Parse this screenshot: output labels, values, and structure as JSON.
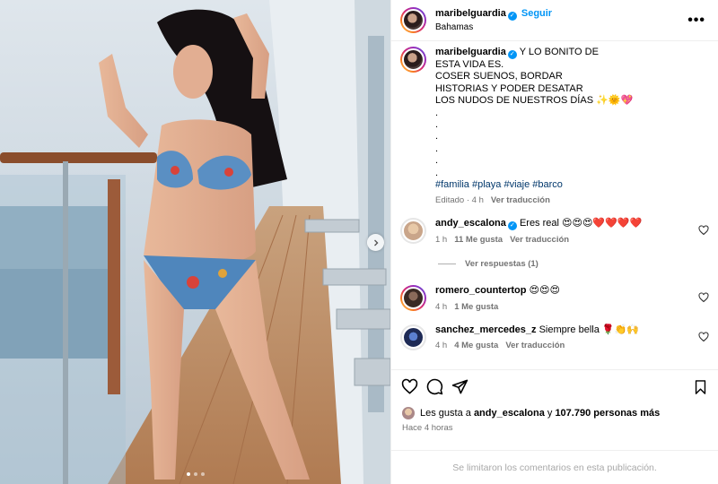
{
  "post": {
    "author": "maribelguardia",
    "follow_label": "Seguir",
    "location": "Bahamas",
    "more_label": "•••"
  },
  "caption": {
    "author": "maribelguardia",
    "lines": [
      "Y LO BONITO DE",
      "ESTA VIDA ES.",
      "COSER SUENOS, BORDAR",
      "HISTORIAS Y PODER DESATAR",
      "LOS NUDOS DE NUESTROS DÍAS ✨🌞💖"
    ],
    "dots": [
      ".",
      ".",
      ".",
      ".",
      ".",
      "."
    ],
    "hashtags": [
      "#familia",
      "#playa",
      "#viaje",
      "#barco"
    ],
    "meta": {
      "edited": "Editado · 4 h",
      "translate": "Ver traducción"
    }
  },
  "comments": [
    {
      "user": "andy_escalona",
      "verified": true,
      "text": "Eres real 😍😍😍❤️❤️❤️❤️",
      "time": "1 h",
      "likes": "11 Me gusta",
      "translate": "Ver traducción",
      "replies": "Ver respuestas (1)"
    },
    {
      "user": "romero_countertop",
      "verified": false,
      "text": "😍😍😍",
      "time": "4 h",
      "likes": "1 Me gusta",
      "translate": ""
    },
    {
      "user": "sanchez_mercedes_z",
      "verified": false,
      "text": "Siempre bella 🌹👏🙌",
      "time": "4 h",
      "likes": "4 Me gusta",
      "translate": "Ver traducción"
    }
  ],
  "likes_line": {
    "prefix": "Les gusta a",
    "user": "andy_escalona",
    "middle": "y",
    "count": "107.790 personas más"
  },
  "time_ago": "Hace 4 horas",
  "comments_limited": "Se limitaron los comentarios en esta publicación.",
  "carousel": {
    "slides": 3,
    "active": 1
  },
  "colors": {
    "accent": "#0095f6",
    "muted": "#737373",
    "hashtag": "#00376b",
    "border": "#efefef"
  },
  "icons": [
    "heart-icon",
    "comment-icon",
    "share-icon",
    "bookmark-icon",
    "verified-icon",
    "chevron-right-icon",
    "more-icon"
  ]
}
